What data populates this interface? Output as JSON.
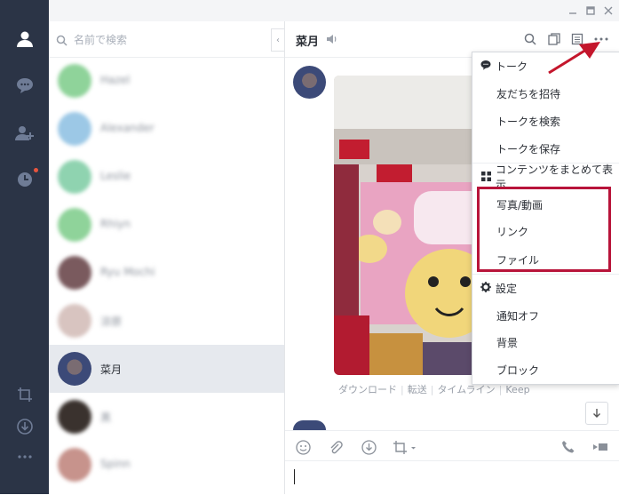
{
  "search": {
    "placeholder": "名前で検索"
  },
  "friends": [
    {
      "name": "Hazel",
      "avatar_color": "#8fd39a",
      "selected": false
    },
    {
      "name": "Alexander",
      "avatar_color": "#9cc8e6",
      "selected": false
    },
    {
      "name": "Leslie",
      "avatar_color": "#8fd3b0",
      "selected": false
    },
    {
      "name": "Rhiyn",
      "avatar_color": "#8fd39a",
      "selected": false
    },
    {
      "name": "Ryu Mochi",
      "avatar_color": "#7a5a5e",
      "selected": false
    },
    {
      "name": "涼原",
      "avatar_color": "#d8c4c0",
      "selected": false
    },
    {
      "name": "菜月",
      "avatar_color": "#3c4a78",
      "selected": true
    },
    {
      "name": "黒",
      "avatar_color": "#3a322e",
      "selected": false
    },
    {
      "name": "Spinn",
      "avatar_color": "#c7938c",
      "selected": false
    }
  ],
  "chat": {
    "title": "菜月",
    "photo_actions": [
      "ダウンロード",
      "転送",
      "タイムライン",
      "Keep"
    ]
  },
  "menu": {
    "talk": "トーク",
    "invite": "友だちを招待",
    "search_talk": "トークを検索",
    "save_talk": "トークを保存",
    "contents": "コンテンツをまとめて表示",
    "photos": "写真/動画",
    "links": "リンク",
    "files": "ファイル",
    "settings": "設定",
    "notify_off": "通知オフ",
    "background": "背景",
    "block": "ブロック"
  },
  "colors": {
    "nav_bg": "#2b3446",
    "highlight": "#b8143a",
    "accent_red": "#e8553e"
  },
  "icons": [
    "person-icon",
    "chat-bubble-icon",
    "add-friend-icon",
    "clock-icon",
    "crop-icon",
    "download-circle-icon",
    "more-icon",
    "search-icon",
    "speaker-icon",
    "copy-icon",
    "notes-icon",
    "more-dots-icon",
    "smile-icon",
    "paperclip-icon",
    "download-icon",
    "crop-icon",
    "phone-icon",
    "video-icon",
    "arrow-down-icon",
    "gear-icon",
    "grid-icon"
  ]
}
